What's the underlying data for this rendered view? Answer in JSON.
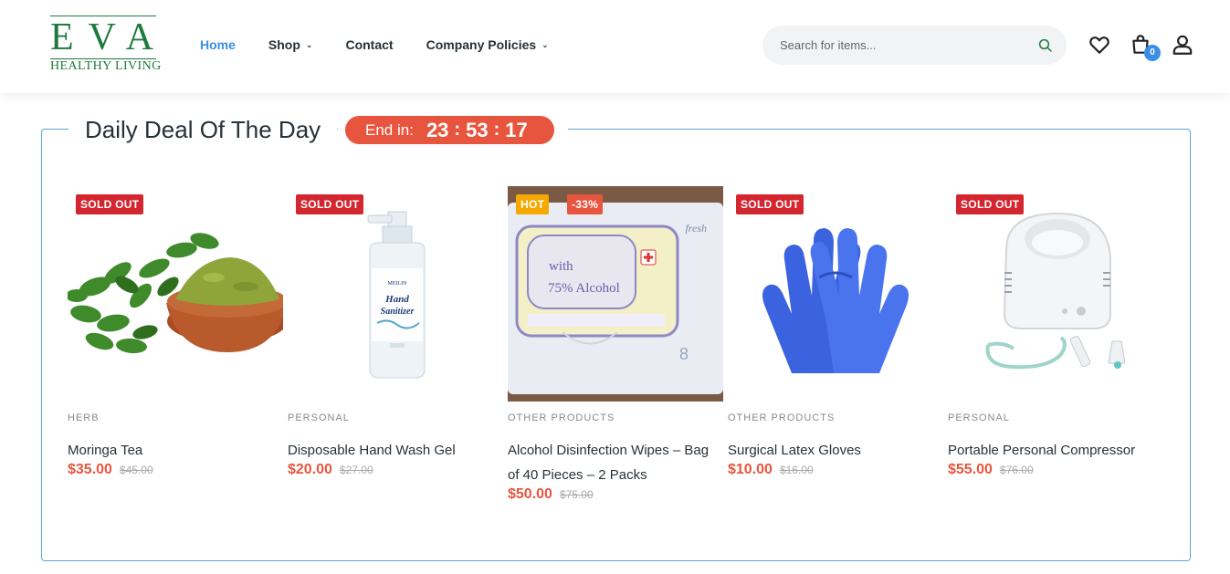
{
  "brand": {
    "logo_main": "EVA",
    "logo_sub": "HEALTHY LIVING"
  },
  "nav": [
    {
      "label": "Home",
      "active": true,
      "dropdown": false
    },
    {
      "label": "Shop",
      "active": false,
      "dropdown": true
    },
    {
      "label": "Contact",
      "active": false,
      "dropdown": false
    },
    {
      "label": "Company Policies",
      "active": false,
      "dropdown": true
    }
  ],
  "search": {
    "placeholder": "Search for items..."
  },
  "header_icons": {
    "wishlist": "heart-icon",
    "cart": "shopping-bag-icon",
    "account": "user-icon",
    "cart_count": "0"
  },
  "deal": {
    "title": "Daily Deal Of The Day",
    "end_label": "End in:",
    "hours": "23",
    "minutes": "53",
    "seconds": "17"
  },
  "products": [
    {
      "badges": [
        "SOLD OUT"
      ],
      "category": "HERB",
      "name": "Moringa Tea",
      "price": "$35.00",
      "old_price": "$45.00"
    },
    {
      "badges": [
        "SOLD OUT"
      ],
      "category": "PERSONAL",
      "name": "Disposable Hand Wash Gel",
      "price": "$20.00",
      "old_price": "$27.00"
    },
    {
      "badges": [
        "HOT",
        "-33%"
      ],
      "category": "OTHER PRODUCTS",
      "name": "Alcohol Disinfection Wipes – Bag of 40 Pieces – 2 Packs",
      "price": "$50.00",
      "old_price": "$75.00"
    },
    {
      "badges": [
        "SOLD OUT"
      ],
      "category": "OTHER PRODUCTS",
      "name": "Surgical Latex Gloves",
      "price": "$10.00",
      "old_price": "$16.00"
    },
    {
      "badges": [
        "SOLD OUT"
      ],
      "category": "PERSONAL",
      "name": "Portable Personal Compressor",
      "price": "$55.00",
      "old_price": "$76.00"
    }
  ],
  "image_text": {
    "sanitizer_label_1": "Hand",
    "sanitizer_label_2": "Sanitizer",
    "wipes_line_1": "with",
    "wipes_line_2": "75% Alcohol",
    "wipes_brand": "fresh"
  },
  "colors": {
    "accent": "#3a8ee6",
    "brand_green": "#1e7a3c",
    "price": "#e8553e",
    "sold_out": "#d3262f",
    "hot": "#f5a900"
  }
}
